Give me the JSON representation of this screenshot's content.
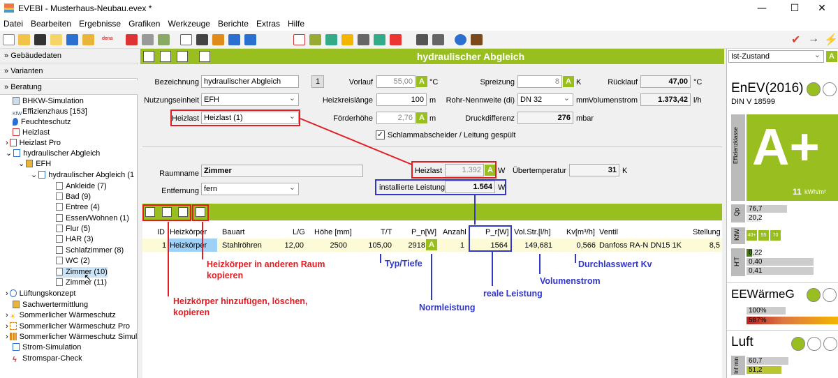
{
  "window": {
    "title": "EVEBI - Musterhaus-Neubau.evex *",
    "min": "—",
    "max": "☐",
    "close": "✕"
  },
  "menu": [
    "Datei",
    "Bearbeiten",
    "Ergebnisse",
    "Grafiken",
    "Werkzeuge",
    "Berichte",
    "Extras",
    "Hilfe"
  ],
  "toolbar_text": {
    "dena": "dena"
  },
  "sidebar": {
    "sections": [
      "Gebäudedaten",
      "Varianten",
      "Beratung"
    ],
    "items": [
      "BHKW-Simulation",
      "Effizienzhaus [153]",
      "Feuchteschutz",
      "Heizlast",
      "Heizlast Pro",
      "hydraulischer Abgleich",
      "EFH",
      "hydraulischer Abgleich (1",
      "Ankleide (7)",
      "Bad (9)",
      "Entree (4)",
      "Essen/Wohnen (1)",
      "Flur (5)",
      "HAR (3)",
      "Schlafzimmer (8)",
      "WC (2)",
      "Zimmer (10)",
      "Zimmer (11)",
      "Lüftungskonzept",
      "Sachwertermittlung",
      "Sommerlicher Wärmeschutz",
      "Sommerlicher Wärmeschutz Pro",
      "Sommerlicher Wärmeschutz Simul",
      "Strom-Simulation",
      "Stromspar-Check"
    ]
  },
  "main": {
    "header": "hydraulischer Abgleich",
    "form": {
      "bezeichnung_label": "Bezeichnung",
      "bezeichnung": "hydraulischer Abgleich",
      "counter": "1",
      "nutzung_label": "Nutzungseinheit",
      "nutzung": "EFH",
      "heizlast_label": "Heizlast",
      "heizlast": "Heizlast (1)",
      "vorlauf_label": "Vorlauf",
      "vorlauf": "55,00",
      "unit_c": "°C",
      "heizkreis_label": "Heizkreislänge",
      "heizkreis": "100",
      "unit_m": "m",
      "foerder_label": "Förderhöhe",
      "foerder": "2,76",
      "unit_m2": "m",
      "spreizung_label": "Spreizung",
      "spreizung": "8",
      "unit_k": "K",
      "rohr_label": "Rohr-Nennweite (di)",
      "rohr": "DN 32",
      "unit_mm": "mm",
      "druck_label": "Druckdifferenz",
      "druck": "276",
      "unit_mbar": "mbar",
      "ruecklauf_label": "Rücklauf",
      "ruecklauf": "47,00",
      "unit_c2": "°C",
      "volstrom_label": "Volumenstrom",
      "volstrom": "1.373,42",
      "unit_lh": "l/h",
      "schlamm": "Schlammabscheider / Leitung gespült",
      "a": "A"
    },
    "room": {
      "raumname_label": "Raumname",
      "raumname": "Zimmer",
      "entfernung_label": "Entfernung",
      "entfernung": "fern",
      "heizlast_label": "Heizlast",
      "heizlast": "1.392",
      "unit_w": "W",
      "uebertemp_label": "Übertemperatur",
      "uebertemp": "31",
      "unit_k": "K",
      "inst_label": "installierte Leistung",
      "inst": "1.564",
      "unit_w2": "W"
    },
    "table": {
      "headers": [
        "ID",
        "Heizkörper",
        "Bauart",
        "L/G",
        "Höhe [mm]",
        "T/T",
        "P_n[W]",
        "Anzahl",
        "P_r[W]",
        "Vol.Str.[l/h]",
        "Kv[m³/h]",
        "Ventil",
        "Stellung"
      ],
      "row": [
        "1",
        "Heizkörper",
        "Stahlröhren",
        "12,00",
        "2500",
        "105,00",
        "2918",
        "1",
        "1564",
        "149,681",
        "0,566",
        "Danfoss RA-N DN15 1K",
        "8,5"
      ]
    }
  },
  "annotations": {
    "copy_room": "Heizkörper in anderen Raum kopieren",
    "add_del": "Heizkörper hinzufügen, löschen, kopieren",
    "typ": "Typ/Tiefe",
    "norm": "Normleistung",
    "real": "reale Leistung",
    "vol": "Volumenstrom",
    "kv": "Durchlasswert Kv"
  },
  "right": {
    "state": "Ist-Zustand",
    "enev": "EnEV(2016)",
    "din": "DIN V 18599",
    "klasse_label": "Effizienzklasse",
    "klasse": "A+",
    "kwh": "11",
    "kwh_unit": "kWh/m²",
    "qp_label": "Qp",
    "qp": [
      "76,7",
      "20,2"
    ],
    "kfw_label": "KfW",
    "kfw": [
      "40+",
      "55",
      "70"
    ],
    "ht_label": "H'T",
    "ht": [
      "0,22",
      "0,40",
      "0,41"
    ],
    "ee": "EEWärmeG",
    "ee_vals": [
      "100%",
      "587%"
    ],
    "luft": "Luft",
    "inf_label": "Inf min",
    "luft_vals": [
      "60,7",
      "51,2"
    ]
  },
  "colors": {
    "accent": "#98bf1f",
    "red": "#e31c23",
    "blue": "#3237c8"
  }
}
